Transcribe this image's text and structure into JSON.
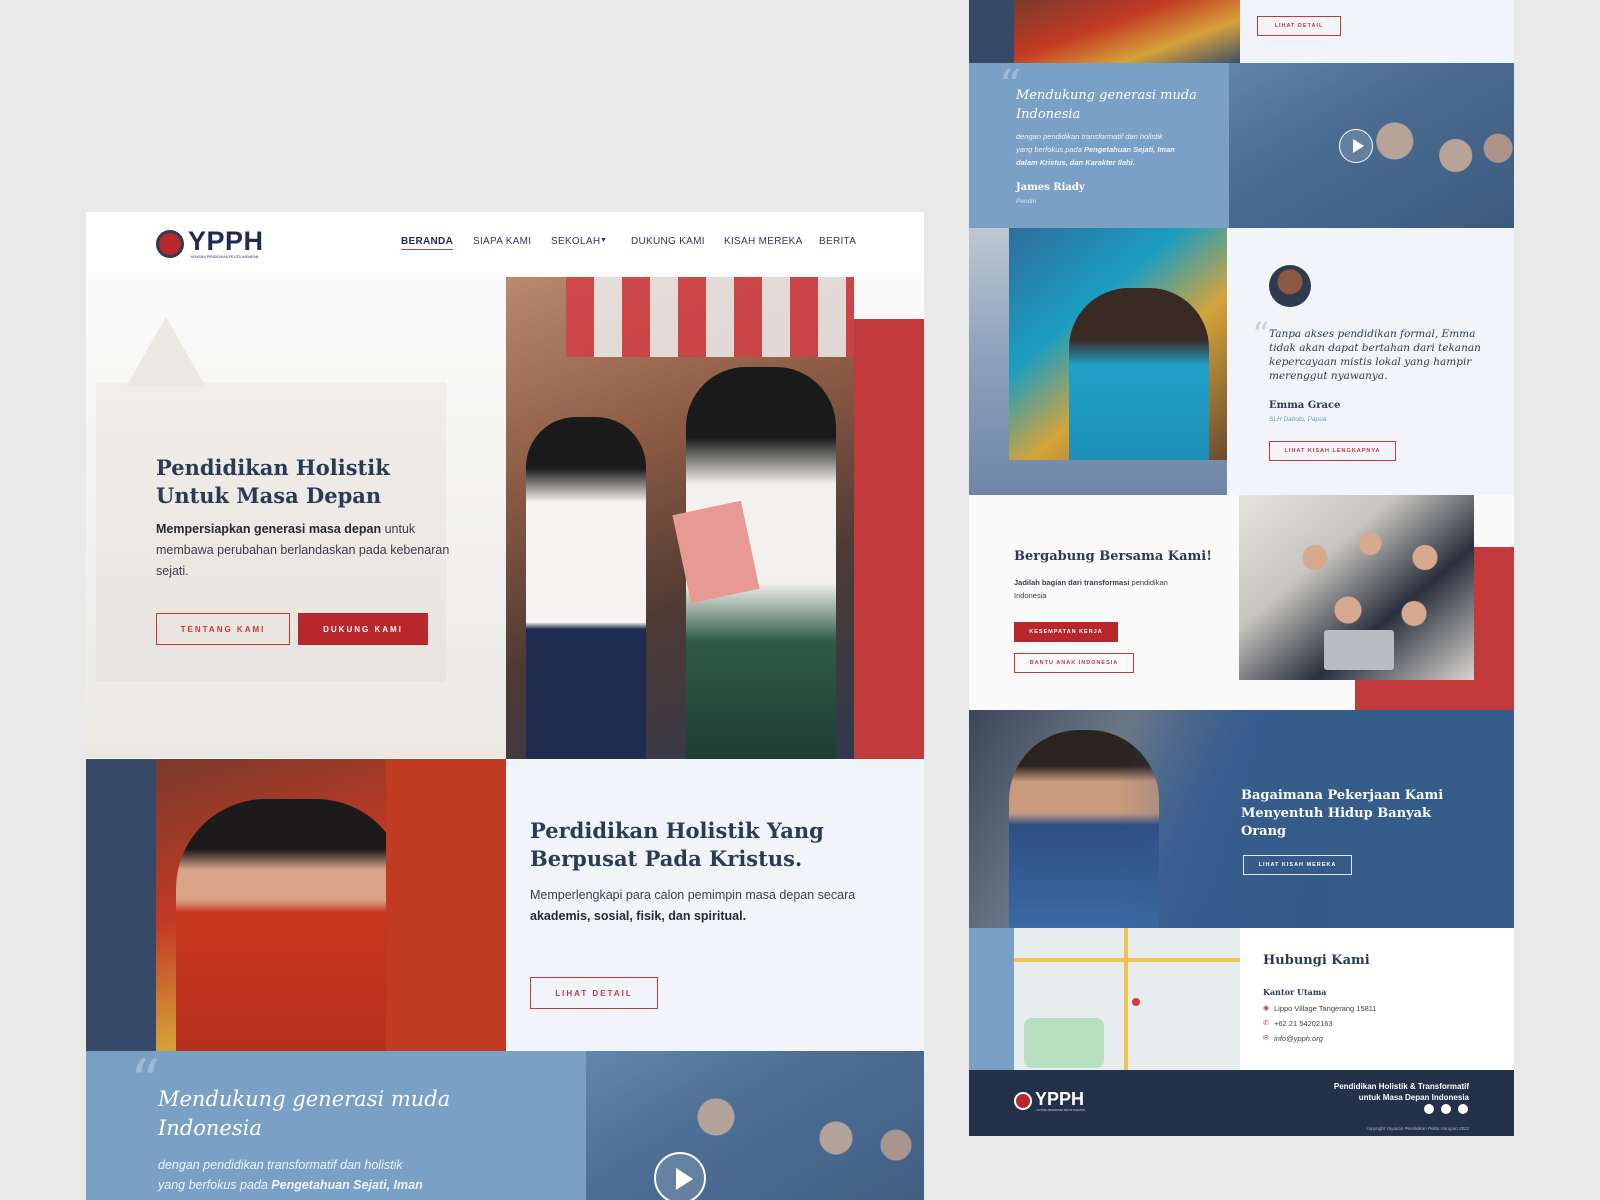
{
  "brand": {
    "logo_text": "YPPH",
    "logo_sub": "YAYASAN PENDIDIKAN PELITA HARAPAN"
  },
  "nav": {
    "items": [
      {
        "label": "BERANDA"
      },
      {
        "label": "SIAPA KAMI"
      },
      {
        "label": "SEKOLAH"
      },
      {
        "label": "DUKUNG KAMI"
      },
      {
        "label": "KISAH MEREKA"
      },
      {
        "label": "BERITA"
      }
    ]
  },
  "hero": {
    "title_l1": "Pendidikan Holistik",
    "title_l2": "Untuk Masa Depan",
    "desc_bold": "Mempersiapkan generasi masa depan",
    "desc_rest": " untuk membawa perubahan berlandaskan pada kebenaran sejati.",
    "btn_about": "TENTANG KAMI",
    "btn_support": "DUKUNG KAMI"
  },
  "section2": {
    "title_l1": "Perdidikan Holistik Yang",
    "title_l2": "Berpusat Pada Kristus.",
    "desc_pre": "Memperlengkapi para calon pemimpin masa depan secara ",
    "desc_bold": "akademis, sosial, fisik, dan spiritual.",
    "btn": "LIHAT DETAIL"
  },
  "quote_left": {
    "title_l1": "Mendukung generasi muda",
    "title_l2": "Indonesia",
    "desc_pre": "dengan pendidikan transformatif dan holistik",
    "desc_pre2": "yang berfokus pada ",
    "desc_bold": "Pengetahuan Sejati, Iman"
  },
  "right": {
    "top_btn": "LIHAT DETAIL",
    "quote": {
      "title_l1": "Mendukung generasi muda",
      "title_l2": "Indonesia",
      "desc_l1": "dengan pendidikan transformatif dan holistik",
      "desc_l2_pre": "yang berfokus pada ",
      "desc_l2_bold": "Pengetahuan Sejati, Iman",
      "desc_l3_bold": "dalam Kristus, dan Karakter Ilahi.",
      "author": "James Riady",
      "role": "Pendiri"
    },
    "story": {
      "quote_l1": "Tanpa akses pendidikan formal, Emma",
      "quote_l2": "tidak akan dapat bertahan dari tekanan",
      "quote_l3": "kepercayaan mistis lokal yang hampir",
      "quote_l4": "merenggut nyawanya.",
      "author": "Emma Grace",
      "location": "SLH Dabolo, Papua",
      "btn": "LIHAT KISAH LENGKAPNYA"
    },
    "join": {
      "title": "Bergabung Bersama Kami!",
      "desc_bold": "Jadilah bagian dari transformasi",
      "desc_rest": " pendidikan",
      "desc_l2": "Indonesia",
      "btn_work": "KESEMPATAN KERJA",
      "btn_help": "BANTU ANAK INDONESIA"
    },
    "impact": {
      "title_l1": "Bagaimana Pekerjaan Kami",
      "title_l2": "Menyentuh Hidup Banyak",
      "title_l3": "Orang",
      "btn": "LIHAT KISAH MEREKA"
    },
    "contact": {
      "title": "Hubungi Kami",
      "office": "Kantor Utama",
      "address": "Lippo Village Tangerang 15811",
      "phone": "+62 21 54202163",
      "email": "info@ypph.org"
    },
    "footer": {
      "tagline_l1": "Pendidikan Holistik & Transformatif",
      "tagline_l2": "untuk Masa Depan Indonesia",
      "copyright": "copyright Yayasan Pendidikan Pelita Harapan 2021"
    }
  },
  "colors": {
    "navy": "#2b3a55",
    "red": "#b8272b",
    "steel_blue": "#6f97c0",
    "light_bg": "#f1f5f9"
  }
}
